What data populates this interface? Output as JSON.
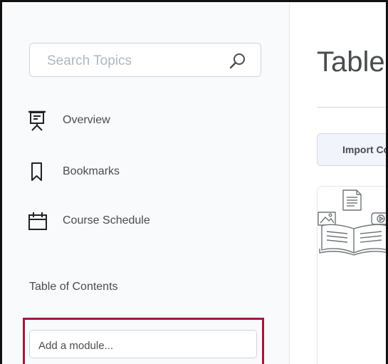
{
  "sidebar": {
    "search": {
      "placeholder": "Search Topics",
      "value": ""
    },
    "nav": [
      {
        "label": "Overview",
        "icon": "presentation-board-icon"
      },
      {
        "label": "Bookmarks",
        "icon": "bookmark-icon"
      },
      {
        "label": "Course Schedule",
        "icon": "calendar-icon"
      }
    ],
    "toc_heading": "Table of Contents",
    "add_module": {
      "placeholder": "Add a module...",
      "value": ""
    }
  },
  "main": {
    "title": "Table",
    "import_button_label": "Import Co"
  },
  "colors": {
    "highlight": "#9b1c3a",
    "sidebar_bg": "#f9fafb",
    "text": "#494c4e",
    "button_bg": "#f1f5fb"
  }
}
